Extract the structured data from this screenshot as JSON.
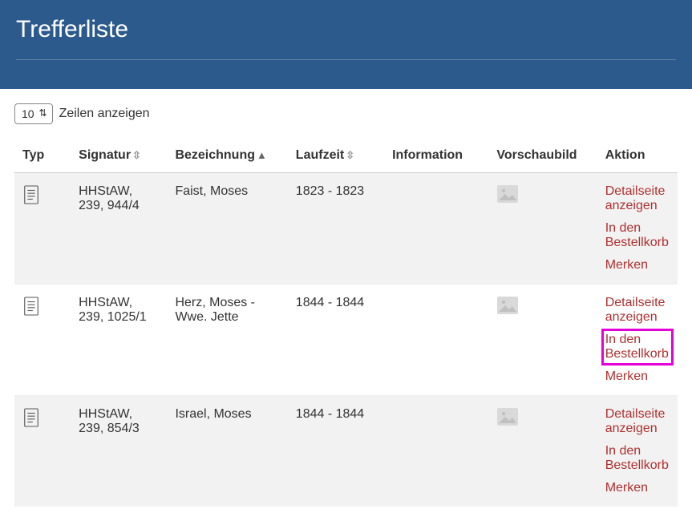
{
  "header": {
    "title": "Trefferliste"
  },
  "rows_control": {
    "value": "10",
    "label": "Zeilen anzeigen"
  },
  "columns": {
    "typ": "Typ",
    "signatur": "Signatur",
    "bezeichnung": "Bezeichnung",
    "laufzeit": "Laufzeit",
    "information": "Information",
    "vorschaubild": "Vorschaubild",
    "aktion": "Aktion"
  },
  "action_labels": {
    "detail": "Detailseite anzeigen",
    "basket": "In den Bestellkorb",
    "remember": "Merken"
  },
  "rows": [
    {
      "signatur": "HHStAW, 239, 944/4",
      "bezeichnung": "Faist, Moses",
      "laufzeit": "1823 - 1823",
      "highlight_basket": false
    },
    {
      "signatur": "HHStAW, 239, 1025/1",
      "bezeichnung": "Herz, Moses - Wwe. Jette",
      "laufzeit": "1844 - 1844",
      "highlight_basket": true
    },
    {
      "signatur": "HHStAW, 239, 854/3",
      "bezeichnung": "Israel, Moses",
      "laufzeit": "1844 - 1844",
      "highlight_basket": false
    }
  ]
}
